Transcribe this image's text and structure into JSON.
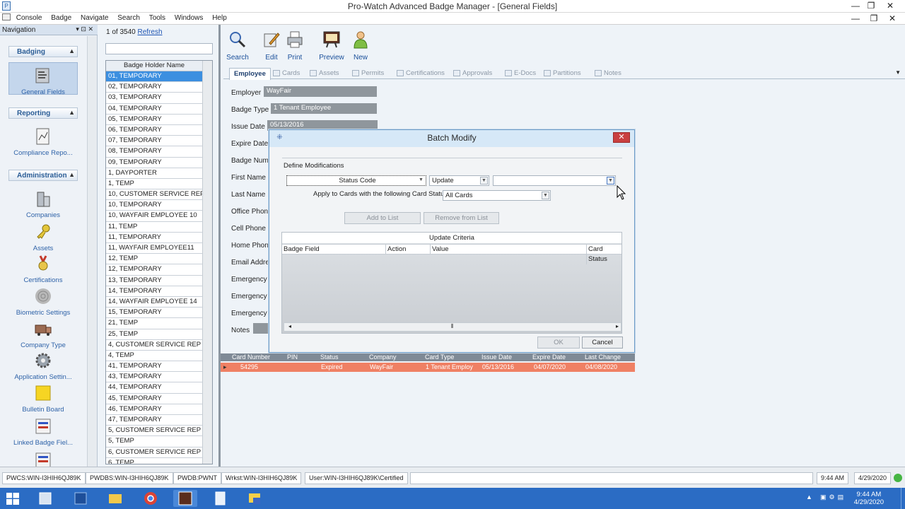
{
  "window": {
    "title": "Pro-Watch Advanced Badge Manager - [General Fields]",
    "app_icon": "P"
  },
  "window_controls": {
    "minimize": "—",
    "restore": "❐",
    "close": "✕",
    "mdi_minimize": "—",
    "mdi_restore": "❐",
    "mdi_close": "✕"
  },
  "menu": [
    "Console",
    "Badge",
    "Navigate",
    "Search",
    "Tools",
    "Windows",
    "Help"
  ],
  "nav": {
    "title": "Navigation",
    "pin": "▾ ⊡ ✕",
    "sections": {
      "badging": "Badging",
      "reporting": "Reporting",
      "administration": "Administration"
    },
    "items": {
      "general_fields": "General Fields",
      "compliance": "Compliance Repo...",
      "companies": "Companies",
      "assets": "Assets",
      "certifications": "Certifications",
      "biometric": "Biometric Settings",
      "company_type": "Company Type",
      "application": "Application Settin...",
      "bulletin": "Bulletin Board",
      "linked": "Linked Badge Fiel..."
    }
  },
  "list": {
    "count_prefix": "1 of 3540",
    "refresh": "Refresh",
    "column": "Badge Holder Name",
    "rows": [
      "01, TEMPORARY",
      "02, TEMPORARY",
      "03, TEMPORARY",
      "04, TEMPORARY",
      "05, TEMPORARY",
      "06, TEMPORARY",
      "07, TEMPORARY",
      "08, TEMPORARY",
      "09, TEMPORARY",
      "1, DAYPORTER",
      "1, TEMP",
      "10, CUSTOMER SERVICE REP",
      "10, TEMPORARY",
      "10, WAYFAIR EMPLOYEE 10",
      "11, TEMP",
      "11, TEMPORARY",
      "11, WAYFAIR EMPLOYEE11",
      "12, TEMP",
      "12, TEMPORARY",
      "13, TEMPORARY",
      "14, TEMPORARY",
      "14, WAYFAIR EMPLOYEE 14",
      "15, TEMPORARY",
      "21, TEMP",
      "25, TEMP",
      "4, CUSTOMER SERVICE REP",
      "4, TEMP",
      "41, TEMPORARY",
      "43, TEMPORARY",
      "44, TEMPORARY",
      "45, TEMPORARY",
      "46, TEMPORARY",
      "47, TEMPORARY",
      "5, CUSTOMER SERVICE REP",
      "5, TEMP",
      "6, CUSTOMER SERVICE REP",
      "6, TEMP"
    ]
  },
  "toolbar": {
    "search": "Search",
    "edit": "Edit",
    "print": "Print",
    "preview": "Preview",
    "new": "New"
  },
  "tabs": [
    "Employee",
    "Cards",
    "Assets",
    "Permits",
    "Certifications",
    "Approvals",
    "E-Docs",
    "Partitions",
    "Notes"
  ],
  "form": {
    "employer_label": "Employer",
    "employer": "WayFair",
    "badge_type_label": "Badge Type",
    "badge_type": "1 Tenant Employee",
    "issue_date_label": "Issue Date",
    "issue_date": "05/13/2016",
    "expire_date_label": "Expire Date",
    "badge_number_label": "Badge Numb",
    "first_name_label": "First Name",
    "last_name_label": "Last Name",
    "office_phone_label": "Office Phone",
    "cell_phone_label": "Cell Phone",
    "home_phone_label": "Home Phone",
    "email_label": "Email Addres",
    "emergency_c_label": "Emergency C",
    "emergency_r_label": "Emergency R",
    "emergency_p_label": "Emergency P",
    "notes_label": "Notes"
  },
  "cards": {
    "columns": [
      "Card Number",
      "PIN",
      "Status",
      "Company",
      "Card Type",
      "Issue Date",
      "Expire Date",
      "Last Change"
    ],
    "row": {
      "expander": "▸",
      "card_number": "54295",
      "pin": "",
      "status": "Expired",
      "company": "WayFair",
      "card_type": "1 Tenant Employ",
      "issue_date": "05/13/2016",
      "expire_date": "04/07/2020",
      "last_change": "04/08/2020"
    }
  },
  "modal": {
    "title": "Batch Modify",
    "close": "✕",
    "define": "Define Modifications",
    "field_combo": "Status Code",
    "action_combo": "Update",
    "value_combo": "",
    "apply_label": "Apply to Cards with the following Card Status",
    "apply_combo": "All Cards",
    "add": "Add to List",
    "remove": "Remove from List",
    "criteria_title": "Update Criteria",
    "criteria_cols": [
      "Badge Field",
      "Action",
      "Value",
      "Card Status"
    ],
    "ok": "OK",
    "cancel": "Cancel"
  },
  "status": [
    "PWCS:WIN-I3HIH6QJ89K",
    "PWDBS:WIN-I3HIH6QJ89K",
    "PWDB:PWNT",
    "Wrkst:WIN-I3HIH6QJ89K",
    "User:WIN-I3HIH6QJ89K\\Certified",
    "9:44 AM",
    "4/29/2020"
  ],
  "taskbar": {
    "time": "9:44 AM",
    "date": "4/29/2020"
  },
  "colors": {
    "selection": "#3c8fe0",
    "expired_row": "#ef8064",
    "taskbar": "#2b6cc4",
    "link": "#1f55b4"
  }
}
